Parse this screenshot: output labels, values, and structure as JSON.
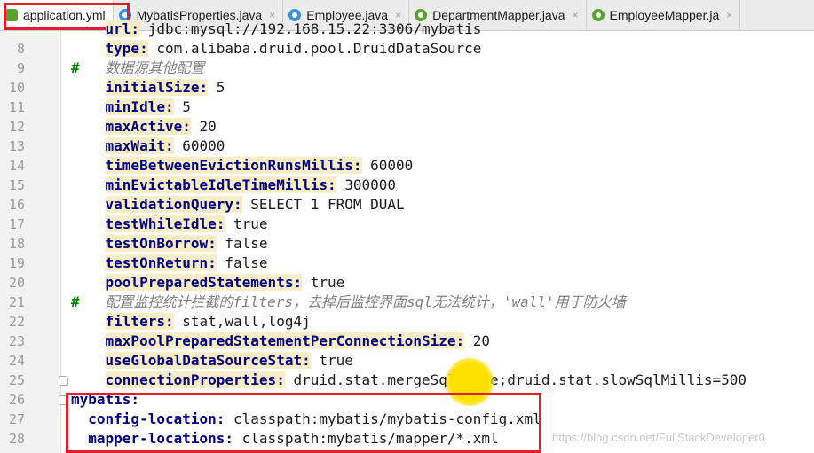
{
  "tabs": [
    {
      "label": "application.yml",
      "icon": "spring-leaf-icon",
      "active": true
    },
    {
      "label": "MybatisProperties.java",
      "icon": "class-icon",
      "active": false
    },
    {
      "label": "Employee.java",
      "icon": "class-icon",
      "active": false
    },
    {
      "label": "DepartmentMapper.java",
      "icon": "interface-icon",
      "active": false
    },
    {
      "label": "EmployeeMapper.ja",
      "icon": "interface-icon",
      "active": false
    }
  ],
  "tab_close_glyph": "×",
  "editor": {
    "lines": [
      {
        "n": "",
        "indent": "    ",
        "key": "url:",
        "value": " jdbc:mysql://192.168.15.22:3306/mybatis"
      },
      {
        "n": "8",
        "indent": "    ",
        "key": "type:",
        "value": " com.alibaba.druid.pool.DruidDataSource"
      },
      {
        "n": "9",
        "hash": "#",
        "comment": "数据源其他配置"
      },
      {
        "n": "10",
        "indent": "    ",
        "key": "initialSize:",
        "value": " 5"
      },
      {
        "n": "11",
        "indent": "    ",
        "key": "minIdle:",
        "value": " 5"
      },
      {
        "n": "12",
        "indent": "    ",
        "key": "maxActive:",
        "value": " 20"
      },
      {
        "n": "13",
        "indent": "    ",
        "key": "maxWait:",
        "value": " 60000"
      },
      {
        "n": "14",
        "indent": "    ",
        "key": "timeBetweenEvictionRunsMillis:",
        "value": " 60000"
      },
      {
        "n": "15",
        "indent": "    ",
        "key": "minEvictableIdleTimeMillis:",
        "value": " 300000"
      },
      {
        "n": "16",
        "indent": "    ",
        "key": "validationQuery:",
        "value": " SELECT 1 FROM DUAL"
      },
      {
        "n": "17",
        "indent": "    ",
        "key": "testWhileIdle:",
        "value": " true"
      },
      {
        "n": "18",
        "indent": "    ",
        "key": "testOnBorrow:",
        "value": " false"
      },
      {
        "n": "19",
        "indent": "    ",
        "key": "testOnReturn:",
        "value": " false"
      },
      {
        "n": "20",
        "indent": "    ",
        "key": "poolPreparedStatements:",
        "value": " true"
      },
      {
        "n": "21",
        "hash": "#",
        "comment": "配置监控统计拦截的filters，去掉后监控界面sql无法统计，'wall'用于防火墙"
      },
      {
        "n": "22",
        "indent": "    ",
        "key": "filters:",
        "value": " stat,wall,log4j"
      },
      {
        "n": "23",
        "indent": "    ",
        "key": "maxPoolPreparedStatementPerConnectionSize:",
        "value": " 20"
      },
      {
        "n": "24",
        "indent": "    ",
        "key": "useGlobalDataSourceStat:",
        "value": " true"
      },
      {
        "n": "25",
        "indent": "    ",
        "key": "connectionProperties:",
        "value": " druid.stat.mergeSql=true;druid.stat.slowSqlMillis=500"
      },
      {
        "n": "26",
        "indent": "",
        "key": "mybatis:",
        "value": "",
        "plain": true
      },
      {
        "n": "27",
        "indent": "  ",
        "key": "config-location:",
        "value": " classpath:mybatis/mybatis-config.xml",
        "plain": true
      },
      {
        "n": "28",
        "indent": "  ",
        "key": "mapper-locations:",
        "value": " classpath:mybatis/mapper/*.xml",
        "plain": true
      }
    ]
  },
  "watermark": "https://blog.csdn.net/FullStackDeveloper0"
}
